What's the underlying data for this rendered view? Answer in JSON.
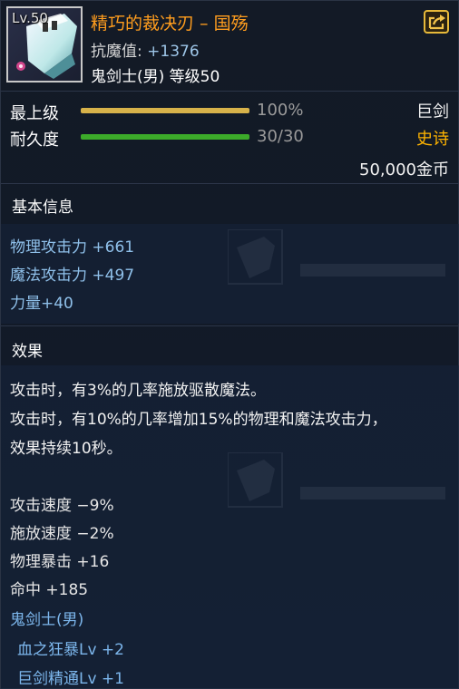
{
  "header": {
    "level_badge": "Lv.50",
    "item_name": "精巧的裁决刃 – 国殇",
    "anti_magic_label": "抗魔值: ",
    "anti_magic_value": "+1376",
    "requirement": "鬼剑士(男) 等级50",
    "icons": {
      "item": "sword-item-icon",
      "share": "share-icon"
    }
  },
  "grade": {
    "label": "最上级",
    "value": "100%",
    "fill_fraction": 1.0,
    "bar_color": "#d7b24a",
    "type_label": "巨剑"
  },
  "durability": {
    "label": "耐久度",
    "value": "30/30",
    "fill_fraction": 1.0,
    "bar_color": "#3cab2a",
    "rarity_label": "史诗",
    "rarity_color": "#ffb400"
  },
  "price": "50,000金币",
  "basic_info": {
    "title": "基本信息",
    "stats": [
      "物理攻击力 +661",
      "魔法攻击力 +497",
      "力量+40"
    ]
  },
  "effects": {
    "title": "效果",
    "description": [
      "攻击时，有3%的几率施放驱散魔法。",
      "攻击时，有10%的几率增加15%的物理和魔法攻击力，",
      "效果持续10秒。"
    ],
    "stats": [
      "攻击速度 −9%",
      "施放速度 −2%",
      "物理暴击 +16",
      "命中 +185"
    ],
    "class_label": "鬼剑士(男)",
    "skills": [
      "血之狂暴Lv +2",
      "巨剑精通Lv +1"
    ]
  }
}
